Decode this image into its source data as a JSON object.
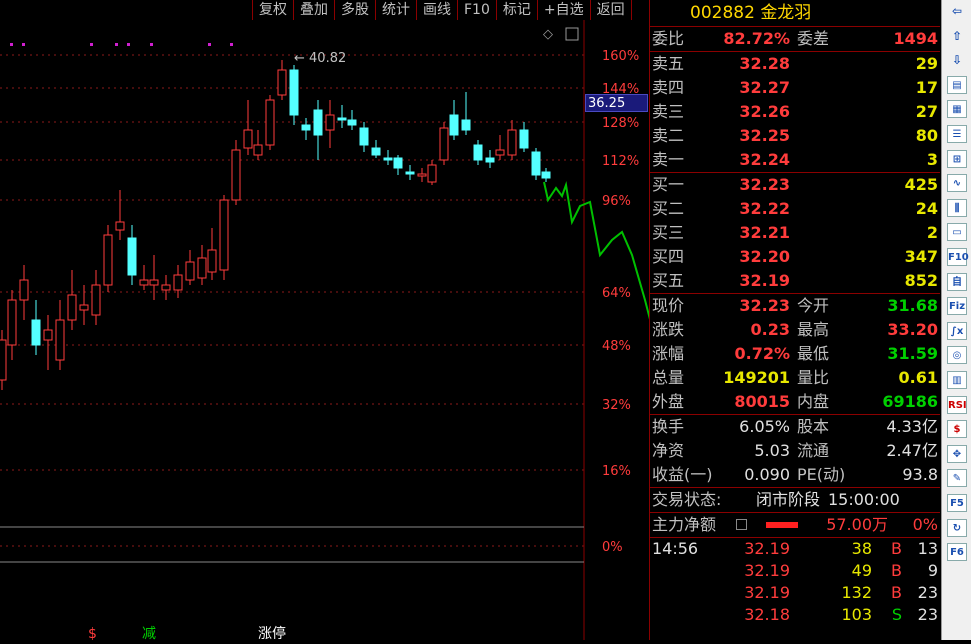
{
  "toolbar": [
    "复权",
    "叠加",
    "多股",
    "统计",
    "画线",
    "F10",
    "标记",
    "+自选",
    "返回"
  ],
  "stock": {
    "code": "002882",
    "name": "金龙羽"
  },
  "chart_data": {
    "type": "candlestick",
    "y_ticks": [
      "160%",
      "144%",
      "128%",
      "112%",
      "96%",
      "64%",
      "48%",
      "32%",
      "16%",
      "0%"
    ],
    "peak_label": "40.82",
    "current_price_badge": "36.25",
    "markers": [
      "$",
      "减",
      "涨停"
    ],
    "prediction_color": "#00c000",
    "up_color": "#ff3c3c",
    "down_color": "#54ffff"
  },
  "wei": {
    "label1": "委比",
    "val1": "82.72%",
    "label2": "委差",
    "val2": "1494"
  },
  "sells": [
    {
      "label": "卖五",
      "price": "32.28",
      "vol": "29"
    },
    {
      "label": "卖四",
      "price": "32.27",
      "vol": "17"
    },
    {
      "label": "卖三",
      "price": "32.26",
      "vol": "27"
    },
    {
      "label": "卖二",
      "price": "32.25",
      "vol": "80"
    },
    {
      "label": "卖一",
      "price": "32.24",
      "vol": "3"
    }
  ],
  "buys": [
    {
      "label": "买一",
      "price": "32.23",
      "vol": "425"
    },
    {
      "label": "买二",
      "price": "32.22",
      "vol": "24"
    },
    {
      "label": "买三",
      "price": "32.21",
      "vol": "2"
    },
    {
      "label": "买四",
      "price": "32.20",
      "vol": "347"
    },
    {
      "label": "买五",
      "price": "32.19",
      "vol": "852"
    }
  ],
  "quote": [
    {
      "l1": "现价",
      "v1": "32.23",
      "l2": "今开",
      "v2": "31.68",
      "c1": "red",
      "c2": "grn"
    },
    {
      "l1": "涨跌",
      "v1": "0.23",
      "l2": "最高",
      "v2": "33.20",
      "c1": "red",
      "c2": "red"
    },
    {
      "l1": "涨幅",
      "v1": "0.72%",
      "l2": "最低",
      "v2": "31.59",
      "c1": "red",
      "c2": "grn"
    },
    {
      "l1": "总量",
      "v1": "149201",
      "l2": "量比",
      "v2": "0.61",
      "c1": "yel",
      "c2": "yel"
    },
    {
      "l1": "外盘",
      "v1": "80015",
      "l2": "内盘",
      "v2": "69186",
      "c1": "red",
      "c2": "grn"
    }
  ],
  "info": [
    {
      "l1": "换手",
      "v1": "6.05%",
      "l2": "股本",
      "v2": "4.33亿"
    },
    {
      "l1": "净资",
      "v1": "5.03",
      "l2": "流通",
      "v2": "2.47亿"
    },
    {
      "l1": "收益(一)",
      "v1": "0.090",
      "l2": "PE(动)",
      "v2": "93.8"
    }
  ],
  "status": {
    "label": "交易状态:",
    "value": "闭市阶段",
    "time": "15:00:00"
  },
  "main": {
    "label": "主力净额",
    "value": "57.00万",
    "pct": "0%"
  },
  "ticks": [
    {
      "time": "14:56",
      "price": "32.19",
      "vol": "38",
      "bs": "B",
      "n": "13"
    },
    {
      "time": "",
      "price": "32.19",
      "vol": "49",
      "bs": "B",
      "n": "9"
    },
    {
      "time": "",
      "price": "32.19",
      "vol": "132",
      "bs": "B",
      "n": "23"
    },
    {
      "time": "",
      "price": "32.18",
      "vol": "103",
      "bs": "S",
      "n": "23"
    }
  ],
  "sidebar_icons": [
    "arrow-left",
    "arrow-up",
    "arrow-down",
    "bar-chart",
    "grid",
    "list",
    "chart",
    "line",
    "candle",
    "notes",
    "f10",
    "zi",
    "fiz",
    "fx",
    "refresh",
    "vol",
    "rsi",
    "dollar",
    "move",
    "pen",
    "f5",
    "refresh2",
    "f6"
  ]
}
